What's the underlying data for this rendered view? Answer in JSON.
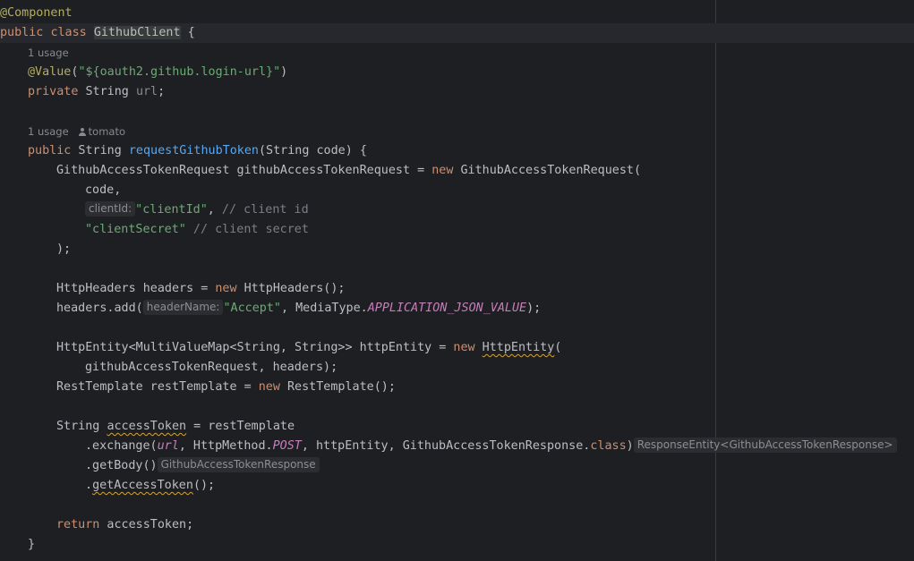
{
  "editor": {
    "annotation_component": "@Component",
    "class_decl": {
      "kw_public": "public",
      "kw_class": "class",
      "class_name": "GithubClient",
      "brace": " {"
    },
    "field_usage": "1 usage",
    "value_annotation": {
      "name": "@Value",
      "open": "(",
      "value": "\"${oauth2.github.login-url}\"",
      "close": ")"
    },
    "field_decl": {
      "kw": "private",
      "type": " String ",
      "name": "url",
      "end": ";"
    },
    "method_usage": "1 usage",
    "method_author": "tomato",
    "method_decl": {
      "kw": "public",
      "type": " String ",
      "name": "requestGithubToken",
      "params": "(String code) {"
    },
    "req_decl": {
      "text": "GithubAccessTokenRequest githubAccessTokenRequest = ",
      "kw_new": "new",
      "rest": " GithubAccessTokenRequest("
    },
    "arg_code": "code,",
    "client_id_hint": "clientId:",
    "client_id_value": "\"clientId\"",
    "client_id_rest": ", ",
    "client_id_comment": "// client id",
    "client_secret_value": "\"clientSecret\"",
    "client_secret_comment": " // client secret",
    "close_args": ");",
    "headers_decl": {
      "text": "HttpHeaders headers = ",
      "kw_new": "new",
      "rest": " HttpHeaders();"
    },
    "headers_add": {
      "call": "headers.add(",
      "hint": "headerName:",
      "value": "\"Accept\"",
      "mid": ", MediaType.",
      "const": "APPLICATION_JSON_VALUE",
      "end": ");"
    },
    "entity_decl": {
      "text": "HttpEntity<MultiValueMap<String, String>> httpEntity = ",
      "kw_new": "new",
      "sp": " ",
      "ctor": "HttpEntity",
      "rest": "("
    },
    "entity_args": "githubAccessTokenRequest, headers);",
    "rest_decl": {
      "text": "RestTemplate restTemplate = ",
      "kw_new": "new",
      "rest": " RestTemplate();"
    },
    "token_decl": {
      "type": "String ",
      "name": "accessToken",
      "rest": " = restTemplate"
    },
    "exchange": {
      "dot": ".exchange(",
      "fld": "url",
      "mid": ", HttpMethod.",
      "const": "POST",
      "mid2": ", httpEntity, GithubAccessTokenResponse.",
      "kw": "class",
      "close": ")",
      "hint": "ResponseEntity<GithubAccessTokenResponse>"
    },
    "get_body": {
      "text": ".getBody()",
      "hint": "GithubAccessTokenResponse"
    },
    "get_token": {
      "dot": ".",
      "name": "getAccessToken",
      "end": "();"
    },
    "return_stmt": {
      "kw": "return",
      "rest": " accessToken;"
    },
    "close_class": "}"
  },
  "colors": {
    "background": "#1e1f22",
    "keyword": "#cf8e6d",
    "string": "#6aab73",
    "function": "#56a8f5",
    "comment": "#7a7e85",
    "constant": "#c77dbb",
    "annotation": "#b3ae60"
  }
}
